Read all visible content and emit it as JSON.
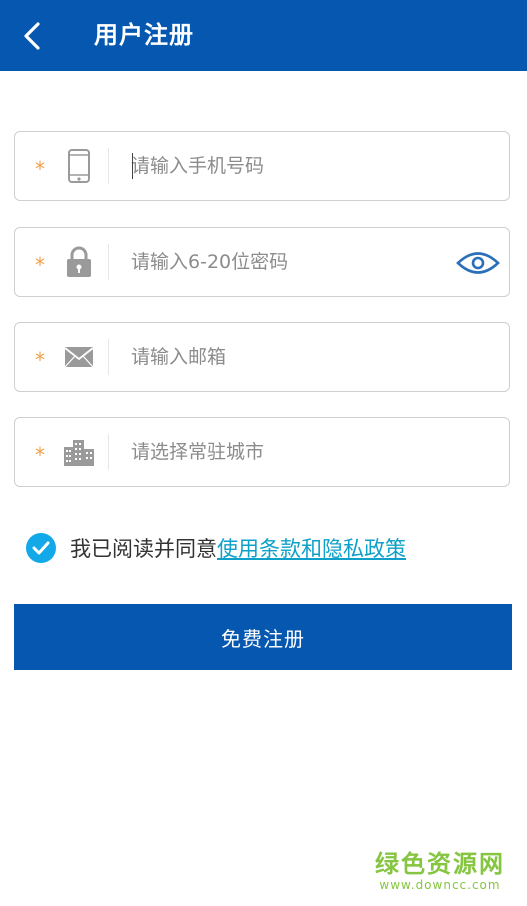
{
  "header": {
    "title": "用户注册",
    "back_icon": "chevron-left-icon"
  },
  "form": {
    "required_mark": "*",
    "phone": {
      "placeholder": "请输入手机号码",
      "icon": "phone-icon"
    },
    "password": {
      "placeholder": "请输入6-20位密码",
      "icon": "lock-icon",
      "toggle_icon": "eye-icon"
    },
    "email": {
      "placeholder": "请输入邮箱",
      "icon": "mail-icon"
    },
    "city": {
      "placeholder": "请选择常驻城市",
      "icon": "city-icon"
    }
  },
  "agreement": {
    "checked": true,
    "text": "我已阅读并同意",
    "link_text": "使用条款和隐私政策"
  },
  "submit": {
    "label": "免费注册"
  },
  "watermark": {
    "main": "绿色资源网",
    "sub": "www.downcc.com"
  },
  "colors": {
    "primary": "#0657b0",
    "required": "#f0a049",
    "link": "#0ea0c9",
    "check": "#13a8e8",
    "watermark": "#86c541"
  }
}
